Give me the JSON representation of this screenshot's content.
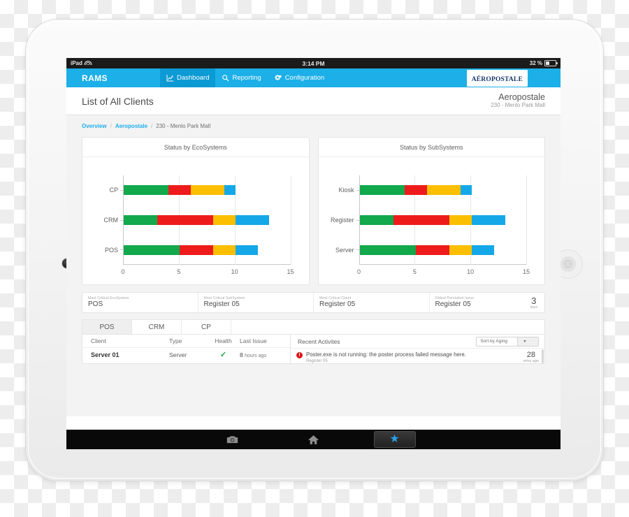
{
  "device": {
    "status_bar": {
      "carrier": "iPad",
      "wifi_icon": "wifi-icon",
      "time": "3:14 PM",
      "battery_percent": "32 %",
      "battery_icon": "battery-icon"
    },
    "app_bar": {
      "camera_icon": "camera-icon",
      "home_icon": "home-icon",
      "star_icon": "star-icon"
    }
  },
  "nav": {
    "brand": "RAMS",
    "items": [
      {
        "label": "Dashboard",
        "icon": "line-chart-icon",
        "active": true
      },
      {
        "label": "Reporting",
        "icon": "search-icon",
        "active": false
      },
      {
        "label": "Configuration",
        "icon": "gears-icon",
        "active": false
      }
    ],
    "logo_text": "AÉROPOSTALE"
  },
  "header": {
    "page_title": "List of All Clients",
    "context_name": "Aeropostale",
    "context_sub": "230 - Menlo Park Mall"
  },
  "breadcrumb": {
    "items": [
      "Overview",
      "Aeropostale",
      "230 -  Menlo Park Mall"
    ],
    "separator": "/"
  },
  "colors": {
    "accent": "#1CAFE8",
    "accent_active": "#0C9AD4",
    "green": "#12A84C",
    "red": "#EE1B1B",
    "amber": "#FBBF00",
    "blue": "#15A8E8",
    "logo_navy": "#17356B",
    "error_red": "#E0151A",
    "check_green": "#18A646"
  },
  "chart_data": [
    {
      "type": "bar",
      "title": "Status by EcoSystems",
      "orientation": "horizontal",
      "stacked": true,
      "categories": [
        "CP",
        "CRM",
        "POS"
      ],
      "series": [
        {
          "name": "green",
          "color": "#12A84C",
          "values": [
            4,
            3,
            5
          ]
        },
        {
          "name": "red",
          "color": "#EE1B1B",
          "values": [
            2,
            5,
            3
          ]
        },
        {
          "name": "amber",
          "color": "#FBBF00",
          "values": [
            3,
            2,
            2
          ]
        },
        {
          "name": "blue",
          "color": "#15A8E8",
          "values": [
            1,
            3,
            2
          ]
        }
      ],
      "totals": [
        10,
        13,
        12
      ],
      "xlabel": "",
      "ylabel": "",
      "xlim": [
        0,
        15
      ],
      "xticks": [
        0,
        5,
        10,
        15
      ],
      "grid": true,
      "legend": "none"
    },
    {
      "type": "bar",
      "title": "Status by SubSystems",
      "orientation": "horizontal",
      "stacked": true,
      "categories": [
        "Kiosk",
        "Register",
        "Server"
      ],
      "series": [
        {
          "name": "green",
          "color": "#12A84C",
          "values": [
            4,
            3,
            5
          ]
        },
        {
          "name": "red",
          "color": "#EE1B1B",
          "values": [
            2,
            5,
            3
          ]
        },
        {
          "name": "amber",
          "color": "#FBBF00",
          "values": [
            3,
            2,
            2
          ]
        },
        {
          "name": "blue",
          "color": "#15A8E8",
          "values": [
            1,
            3,
            2
          ]
        }
      ],
      "totals": [
        10,
        13,
        12
      ],
      "xlabel": "",
      "ylabel": "",
      "xlim": [
        0,
        15
      ],
      "xticks": [
        0,
        5,
        10,
        15
      ],
      "grid": true,
      "legend": "none"
    }
  ],
  "kpis": [
    {
      "label": "Most Critical EcoSystem",
      "value": "POS"
    },
    {
      "label": "Most Critical SubSystem",
      "value": "Register 05"
    },
    {
      "label": "Most Critical Client",
      "value": "Register 05"
    },
    {
      "label": "Oldest Persistent Issue",
      "value": "Register 05",
      "aside_value": "3",
      "aside_unit": "days"
    }
  ],
  "panel": {
    "tabs": [
      {
        "label": "POS",
        "active": true
      },
      {
        "label": "CRM",
        "active": false
      },
      {
        "label": "CP",
        "active": false
      }
    ],
    "table": {
      "columns": [
        "Client",
        "Type",
        "Health",
        "Last Issue"
      ],
      "rows": [
        {
          "client": "Server 01",
          "type": "Server",
          "health": "✓",
          "last_issue_num": "8",
          "last_issue_unit": "hours ago"
        }
      ]
    },
    "activity": {
      "title": "Recent Activites",
      "sort": {
        "value": "Sort by Aging",
        "caret_icon": "chevron-down-icon"
      },
      "items": [
        {
          "icon": "error-icon",
          "message": "Poster.exe is not running: the poster process failed message here.",
          "source": "Register 05",
          "age_value": "28",
          "age_unit": "mins ago"
        }
      ]
    }
  }
}
